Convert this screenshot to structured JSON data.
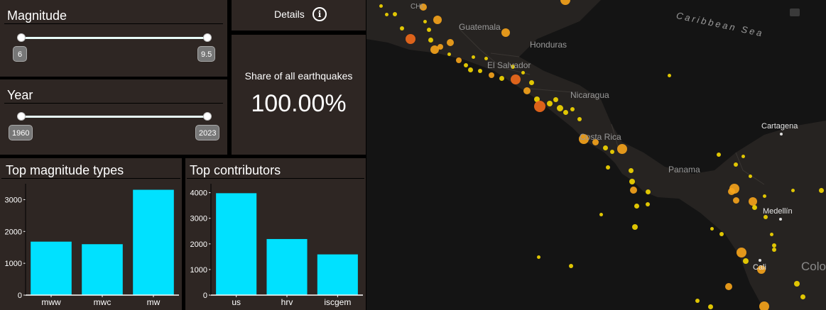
{
  "magnitude": {
    "title": "Magnitude",
    "min": "6",
    "max": "9.5"
  },
  "year": {
    "title": "Year",
    "min": "1960",
    "max": "2023"
  },
  "details": {
    "label": "Details",
    "icon": "info-icon"
  },
  "share": {
    "label": "Share of all earthquakes",
    "value": "100.00%"
  },
  "chart_data": [
    {
      "type": "bar",
      "title": "Top magnitude types",
      "categories": [
        "mww",
        "mwc",
        "mw"
      ],
      "values": [
        1680,
        1600,
        3310
      ],
      "yticks": [
        "0",
        "1000",
        "2000",
        "3000"
      ],
      "ylim": [
        0,
        3500
      ],
      "color": "#00e1ff"
    },
    {
      "type": "bar",
      "title": "Top contributors",
      "categories": [
        "us",
        "hrv",
        "iscgem"
      ],
      "values": [
        3980,
        2190,
        1590
      ],
      "yticks": [
        "0",
        "1000",
        "2000",
        "3000",
        "4000"
      ],
      "ylim": [
        0,
        4350
      ],
      "color": "#00e1ff"
    }
  ],
  "map": {
    "colors": {
      "land": "#262321",
      "sea": "#141414",
      "quake_small": "#f5d800",
      "quake_mid": "#f7a41b",
      "quake_large": "#f26a1b"
    },
    "labels": {
      "caribbean": "Caribbean Sea",
      "chi": "CHI.",
      "guatemala": "Guatemala",
      "honduras": "Honduras",
      "el_salvador": "El Salvador",
      "nicaragua": "Nicaragua",
      "costa_rica": "Costa Rica",
      "panama": "Panama",
      "cartagena": "Cartagena",
      "medellin": "Medellín",
      "cali": "Cali",
      "colombia": "Colo"
    },
    "camera_icon": "camera-icon"
  }
}
